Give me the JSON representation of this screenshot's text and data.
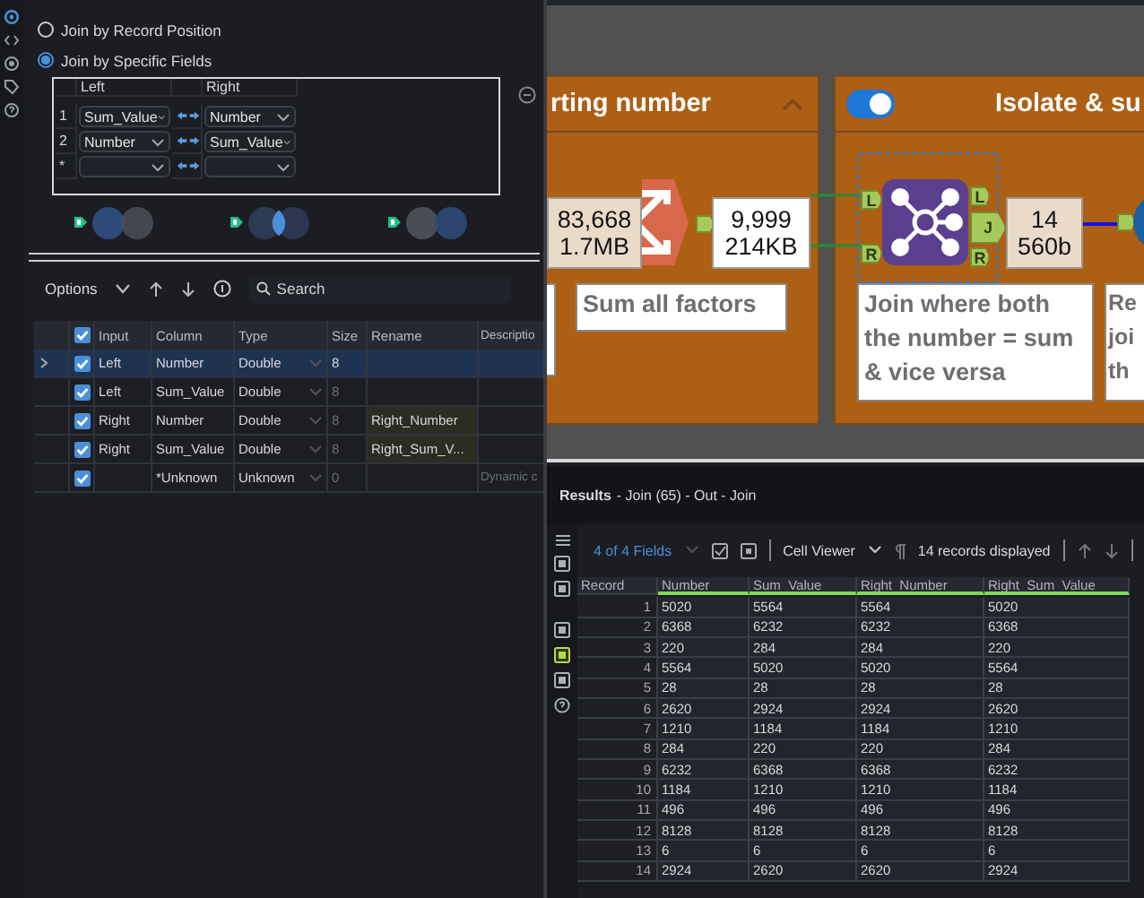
{
  "config": {
    "sidebar_tabs": [
      {
        "kind": "settings",
        "selected": true
      },
      {
        "kind": "code",
        "selected": false
      },
      {
        "kind": "target",
        "selected": false
      },
      {
        "kind": "tag",
        "selected": false
      },
      {
        "kind": "help",
        "selected": false
      }
    ],
    "join_modes": [
      {
        "label": "Join by Record Position",
        "selected": false
      },
      {
        "label": "Join by Specific Fields",
        "selected": true
      }
    ],
    "field_columns": [
      "Left",
      "Right"
    ],
    "field_pairs": [
      {
        "index": "1",
        "left": "Sum_Value",
        "right": "Number"
      },
      {
        "index": "2",
        "left": "Number",
        "right": "Sum_Value"
      },
      {
        "index": "*"
      }
    ],
    "join_outputs": [
      {
        "kind": "left"
      },
      {
        "kind": "inner"
      },
      {
        "kind": "right"
      }
    ]
  },
  "toolbar": {
    "options": "Options",
    "search_placeholder": "Search"
  },
  "select_table": {
    "columns": [
      "Input",
      "Column",
      "Type",
      "Size",
      "Rename",
      "Descriptio"
    ],
    "rows": [
      {
        "selected": true,
        "checked": true,
        "input": "Left",
        "column": "Number",
        "type": "Double",
        "size": "8"
      },
      {
        "selected": false,
        "checked": true,
        "input": "Left",
        "column": "Sum_Value",
        "type": "Double",
        "size": "8"
      },
      {
        "selected": false,
        "checked": true,
        "input": "Right",
        "column": "Number",
        "type": "Double",
        "size": "8",
        "rename": "Right_Number"
      },
      {
        "selected": false,
        "checked": true,
        "input": "Right",
        "column": "Sum_Value",
        "type": "Double",
        "size": "8",
        "rename": "Right_Sum_V..."
      },
      {
        "selected": false,
        "checked": true,
        "column": "*Unknown",
        "type": "Unknown",
        "size": "0",
        "description": "Dynamic c"
      }
    ]
  },
  "canvas": {
    "containers": [
      {
        "title": "rting number",
        "expanded": true
      },
      {
        "title": "Isolate & su",
        "enabled": true
      }
    ],
    "record_counts": [
      {
        "count": "83,668",
        "size": "1.7MB"
      },
      {
        "count": "9,999",
        "size": "214KB"
      },
      {
        "count": "14",
        "size": "560b"
      }
    ],
    "join_tool": {
      "selected": true,
      "inputs": [
        "L",
        "R"
      ],
      "outputs": [
        "L",
        "J",
        "R"
      ]
    },
    "comments": [
      "Sum all factors",
      "Join where both the number = sum & vice versa",
      "Re joi th"
    ]
  },
  "results": {
    "title": "Results",
    "subtitle": "- Join (65) - Out - Join",
    "view_tabs": [
      {
        "kind": "list",
        "selected": false
      },
      {
        "kind": "page",
        "selected": false
      },
      {
        "kind": "page",
        "selected": false
      },
      {
        "kind": "page",
        "selected": false
      },
      {
        "kind": "page",
        "selected": true
      },
      {
        "kind": "page",
        "selected": false
      },
      {
        "kind": "help",
        "selected": false
      }
    ],
    "fields": "4 of 4 Fields",
    "viewer": "Cell Viewer",
    "records": "14 records displayed",
    "columns": [
      "Record",
      "Number",
      "Sum_Value",
      "Right_Number",
      "Right_Sum_Value"
    ],
    "rows": [
      [
        "1",
        "5020",
        "5564",
        "5564",
        "5020"
      ],
      [
        "2",
        "6368",
        "6232",
        "6232",
        "6368"
      ],
      [
        "3",
        "220",
        "284",
        "284",
        "220"
      ],
      [
        "4",
        "5564",
        "5020",
        "5020",
        "5564"
      ],
      [
        "5",
        "28",
        "28",
        "28",
        "28"
      ],
      [
        "6",
        "2620",
        "2924",
        "2924",
        "2620"
      ],
      [
        "7",
        "1210",
        "1184",
        "1184",
        "1210"
      ],
      [
        "8",
        "284",
        "220",
        "220",
        "284"
      ],
      [
        "9",
        "6232",
        "6368",
        "6368",
        "6232"
      ],
      [
        "10",
        "1184",
        "1210",
        "1210",
        "1184"
      ],
      [
        "11",
        "496",
        "496",
        "496",
        "496"
      ],
      [
        "12",
        "8128",
        "8128",
        "8128",
        "8128"
      ],
      [
        "13",
        "6",
        "6",
        "6",
        "6"
      ],
      [
        "14",
        "2924",
        "2620",
        "2620",
        "2924"
      ]
    ]
  }
}
